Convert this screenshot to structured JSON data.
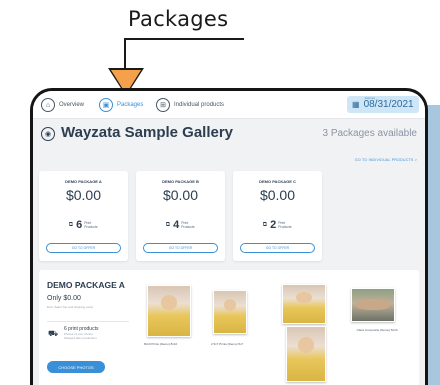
{
  "callout": {
    "label": "Packages"
  },
  "nav": {
    "items": [
      {
        "label": "Overview",
        "icon": "home-icon"
      },
      {
        "label": "Packages",
        "icon": "package-icon",
        "active": true
      },
      {
        "label": "Individual products",
        "icon": "products-icon"
      }
    ],
    "date": {
      "label": "Expires",
      "value": "08/31/2021",
      "icon": "calendar-icon"
    }
  },
  "gallery": {
    "title": "Wayzata Sample Gallery",
    "packages_available": "3 Packages available",
    "goto_individual": "GO TO INDIVIDUAL PRODUCTS >"
  },
  "packages": [
    {
      "name": "DEMO PACKAGE A",
      "price": "$0.00",
      "count": "6",
      "count_label": "Print Products",
      "button": "GO TO OFFER"
    },
    {
      "name": "DEMO PACKAGE B",
      "price": "$0.00",
      "count": "4",
      "count_label": "Print Products",
      "button": "GO TO OFFER"
    },
    {
      "name": "DEMO PACKAGE C",
      "price": "$0.00",
      "count": "2",
      "count_label": "Print Products",
      "button": "GO TO OFFER"
    }
  ],
  "detail": {
    "title": "DEMO PACKAGE A",
    "price": "Only $0.00",
    "note": "Excl. Sales Tax and shipping costs",
    "products_label": "6 print products",
    "products_sub1": "Photos of your choice",
    "products_sub2": "Shipped after production",
    "choose_button": "CHOOSE PHOTOS",
    "photos": [
      {
        "caption": "8x10 Prints (Demo) 8x10"
      },
      {
        "caption": "2 5x7 Prints (Demo) 5x7"
      },
      {
        "caption": ""
      },
      {
        "caption": "Class Composite (Demo) 8x10"
      }
    ]
  },
  "colors": {
    "accent": "#3a8fd6",
    "callout_arrow": "#f5a04a",
    "backdrop": "#a8c6de",
    "date_bg": "#cfe6f7"
  }
}
